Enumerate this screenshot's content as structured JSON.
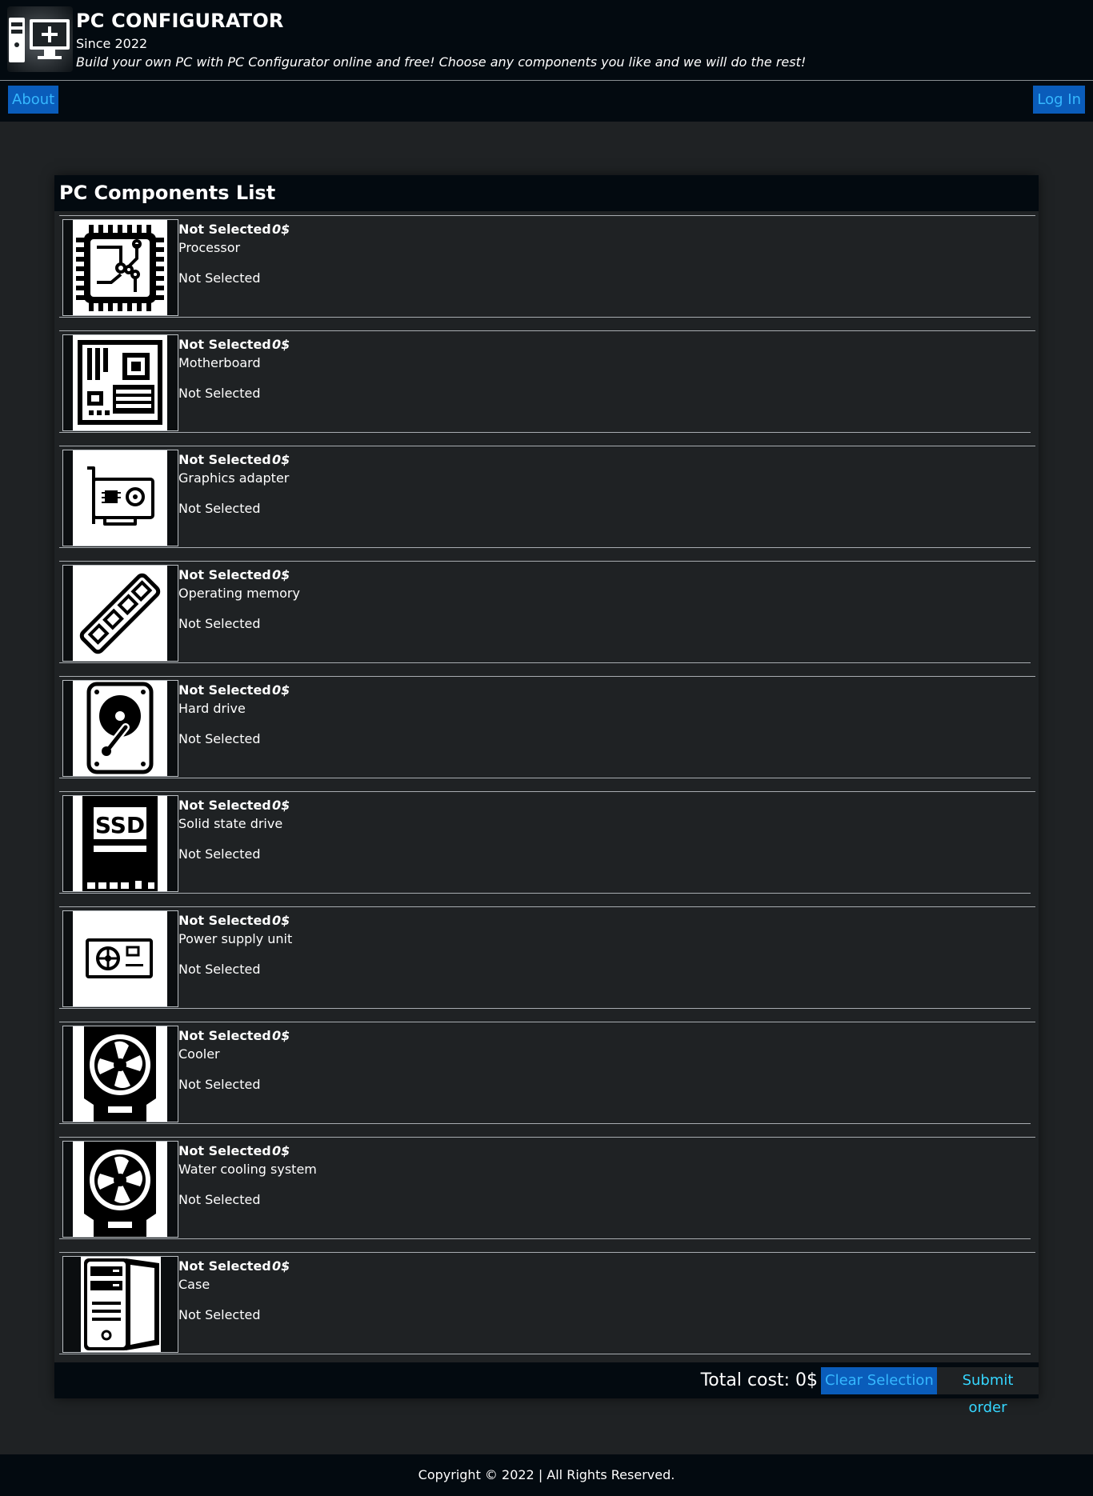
{
  "brand": {
    "title": "PC CONFIGURATOR",
    "since": "Since 2022",
    "tagline": "Build your own PC with PC Configurator online and free! Choose any components you like and we will do the rest!",
    "logo_icon": "pc-configurator-logo-icon"
  },
  "nav": {
    "about_label": "About",
    "login_label": "Log In"
  },
  "components": {
    "title": "PC Components List",
    "items": [
      {
        "name": "Not Selected",
        "price": "0$",
        "category": "Processor",
        "status": "Not Selected",
        "icon": "processor-icon"
      },
      {
        "name": "Not Selected",
        "price": "0$",
        "category": "Motherboard",
        "status": "Not Selected",
        "icon": "motherboard-icon"
      },
      {
        "name": "Not Selected",
        "price": "0$",
        "category": "Graphics adapter",
        "status": "Not Selected",
        "icon": "graphics-card-icon"
      },
      {
        "name": "Not Selected",
        "price": "0$",
        "category": "Operating memory",
        "status": "Not Selected",
        "icon": "ram-icon"
      },
      {
        "name": "Not Selected",
        "price": "0$",
        "category": "Hard drive",
        "status": "Not Selected",
        "icon": "hard-drive-icon"
      },
      {
        "name": "Not Selected",
        "price": "0$",
        "category": "Solid state drive",
        "status": "Not Selected",
        "icon": "ssd-icon"
      },
      {
        "name": "Not Selected",
        "price": "0$",
        "category": "Power supply unit",
        "status": "Not Selected",
        "icon": "power-supply-icon"
      },
      {
        "name": "Not Selected",
        "price": "0$",
        "category": "Cooler",
        "status": "Not Selected",
        "icon": "cooler-icon"
      },
      {
        "name": "Not Selected",
        "price": "0$",
        "category": "Water cooling system",
        "status": "Not Selected",
        "icon": "water-cooling-icon"
      },
      {
        "name": "Not Selected",
        "price": "0$",
        "category": "Case",
        "status": "Not Selected",
        "icon": "pc-case-icon"
      }
    ],
    "ssd_label": "SSD"
  },
  "summary": {
    "total_label": "Total cost: 0$",
    "clear_label": "Clear Selection",
    "submit_label": "Submit order"
  },
  "footer": {
    "copyright": "Copyright © 2022 | All Rights Reserved."
  },
  "colors": {
    "header_bg": "#030a10",
    "page_bg": "#1f2224",
    "accent_button": "#0a5cba",
    "accent_text": "#35b8ff"
  }
}
